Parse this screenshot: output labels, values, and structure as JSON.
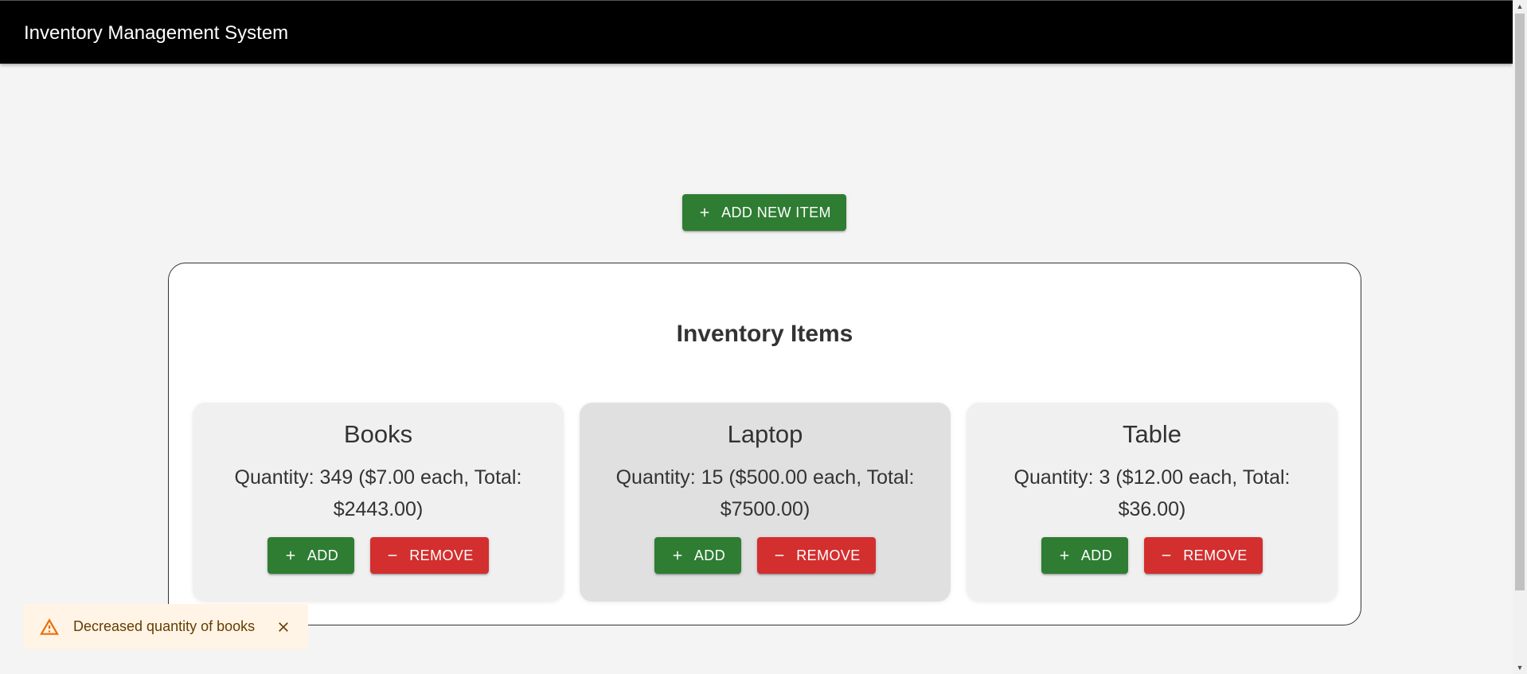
{
  "appbar": {
    "title": "Inventory Management System"
  },
  "toolbar": {
    "add_new_label": "ADD NEW ITEM"
  },
  "panel": {
    "title": "Inventory Items"
  },
  "items": [
    {
      "name": "Books",
      "detail": "Quantity: 349 ($7.00 each, Total: $2443.00)",
      "add_label": "ADD",
      "remove_label": "REMOVE"
    },
    {
      "name": "Laptop",
      "detail": "Quantity: 15 ($500.00 each, Total: $7500.00)",
      "add_label": "ADD",
      "remove_label": "REMOVE"
    },
    {
      "name": "Table",
      "detail": "Quantity: 3 ($12.00 each, Total: $36.00)",
      "add_label": "ADD",
      "remove_label": "REMOVE"
    }
  ],
  "toast": {
    "message": "Decreased quantity of books",
    "severity": "warning"
  },
  "colors": {
    "appbar": "#000000",
    "success": "#2e7d32",
    "danger": "#d32f2f",
    "warning_bg": "#fff4e5",
    "warning_icon": "#ed6c02"
  },
  "icons": {
    "add": "plus-icon",
    "remove": "minus-icon",
    "toast": "warning-icon",
    "close": "close-icon"
  }
}
